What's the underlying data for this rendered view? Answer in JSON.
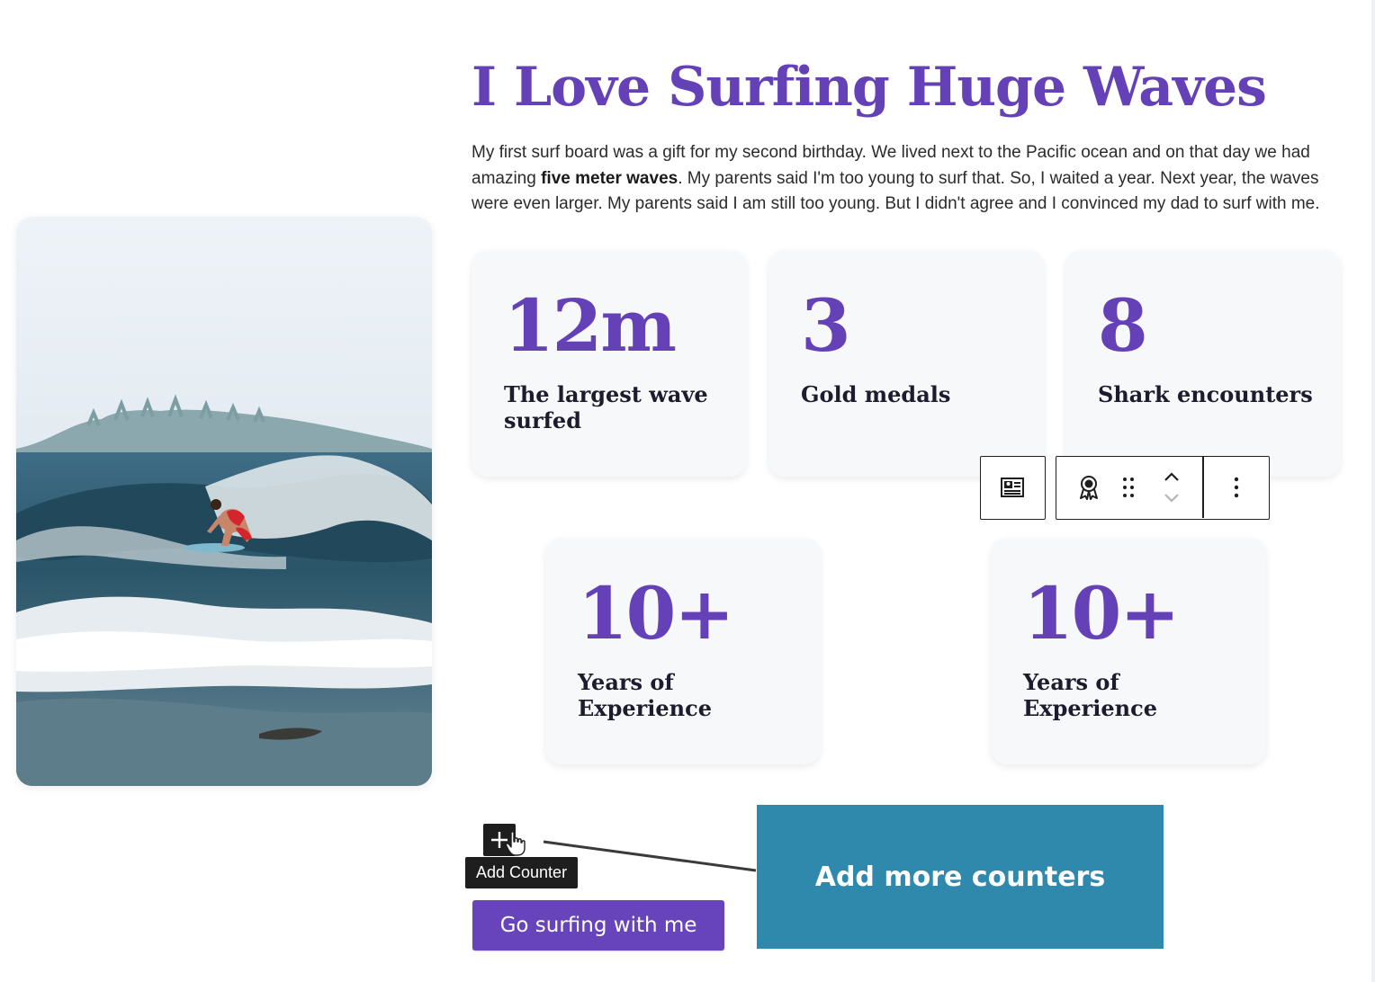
{
  "page": {
    "title": "I Love Surfing Huge Waves",
    "intro": {
      "before": "My first surf board was a gift for my second birthday. We lived next to the Pacific ocean and on that day we had amazing ",
      "bold": "five meter waves",
      "after": ". My parents said I'm too young to surf that. So, I waited a year. Next year, the waves were even larger. My parents said I am still too young. But I didn't agree and I convinced my dad to surf with me."
    }
  },
  "counters": [
    {
      "number": "12m",
      "label": "The largest wave surfed"
    },
    {
      "number": "3",
      "label": "Gold medals"
    },
    {
      "number": "8",
      "label": "Shark encounters"
    },
    {
      "number": "10+",
      "label": "Years of Experience"
    },
    {
      "number": "10+",
      "label": "Years of Experience"
    }
  ],
  "toolbar": {
    "icons": [
      "media-text-icon",
      "award-icon",
      "drag-handle-icon",
      "chevron-up-icon",
      "chevron-down-icon",
      "more-vertical-icon"
    ]
  },
  "add_counter": {
    "tooltip": "Add Counter",
    "icon": "plus-icon"
  },
  "cta": {
    "label": "Go surfing with me"
  },
  "annotation": {
    "text": "Add more counters"
  },
  "colors": {
    "accent": "#6441b7",
    "button": "#6744bb",
    "annotation": "#2e89ad",
    "card": "#f7f8fa",
    "toolbar": "#1e1e1e"
  }
}
